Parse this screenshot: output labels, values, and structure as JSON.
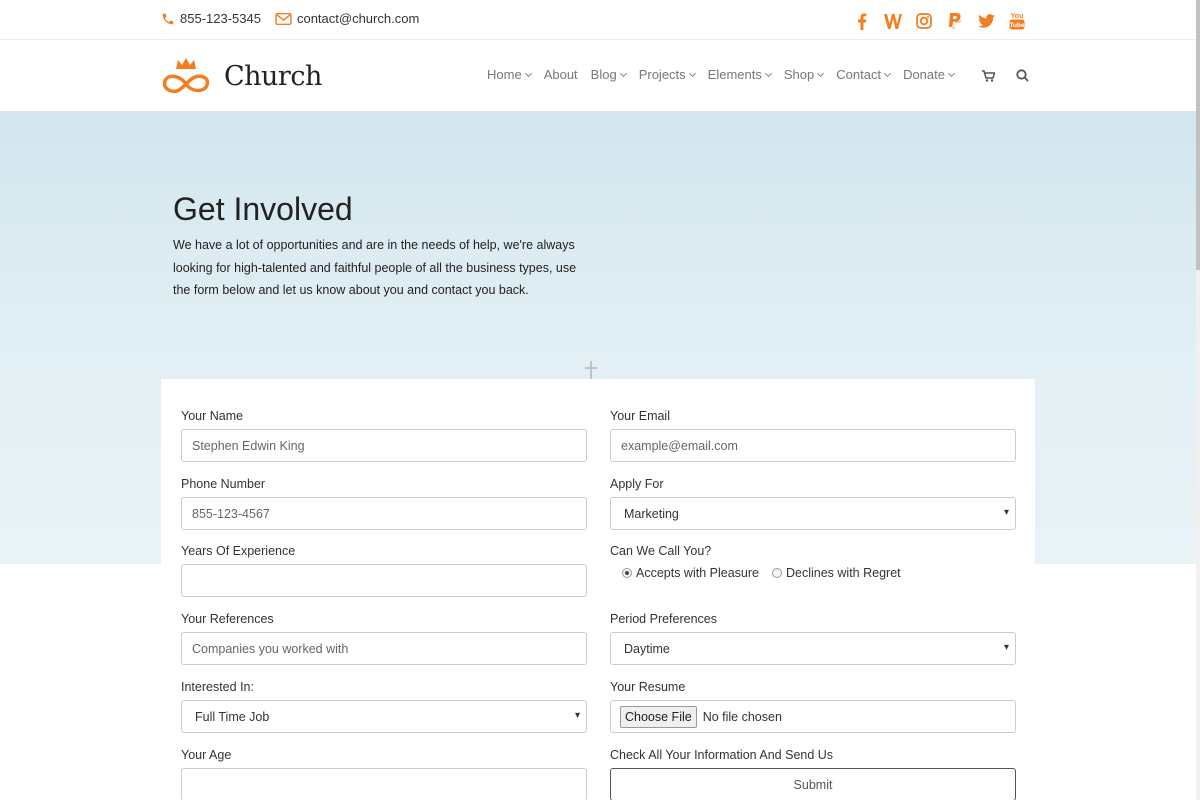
{
  "topbar": {
    "phone": "855-123-5345",
    "email": "contact@church.com",
    "social": [
      "facebook-icon",
      "w-icon",
      "instagram-icon",
      "paypal-icon",
      "twitter-icon",
      "youtube-icon"
    ]
  },
  "brand": {
    "name": "Church",
    "accent": "#f47d20"
  },
  "nav": {
    "items": [
      {
        "label": "Home",
        "dropdown": true
      },
      {
        "label": "About",
        "dropdown": false
      },
      {
        "label": "Blog",
        "dropdown": true
      },
      {
        "label": "Projects",
        "dropdown": true
      },
      {
        "label": "Elements",
        "dropdown": true
      },
      {
        "label": "Shop",
        "dropdown": true
      },
      {
        "label": "Contact",
        "dropdown": true
      },
      {
        "label": "Donate",
        "dropdown": true
      }
    ]
  },
  "hero": {
    "title": "Get Involved",
    "text": "We have a lot of opportunities and are in the needs of help, we're always looking for high-talented and faithful people of all the business types, use the form below and let us know about you and contact you back."
  },
  "form": {
    "name": {
      "label": "Your Name",
      "value": "Stephen Edwin King"
    },
    "email": {
      "label": "Your Email",
      "placeholder": "example@email.com"
    },
    "phone": {
      "label": "Phone Number",
      "value": "855-123-4567"
    },
    "apply": {
      "label": "Apply For",
      "selected": "Marketing"
    },
    "experience": {
      "label": "Years Of Experience",
      "value": ""
    },
    "callback": {
      "label": "Can We Call You?",
      "option_yes": "Accepts with Pleasure",
      "option_no": "Declines with Regret"
    },
    "references": {
      "label": "Your References",
      "placeholder": "Companies you worked with"
    },
    "period": {
      "label": "Period Preferences",
      "selected": "Daytime"
    },
    "interested": {
      "label": "Interested In:",
      "selected": "Full Time Job"
    },
    "resume": {
      "label": "Your Resume",
      "button": "Choose File",
      "status": "No file chosen"
    },
    "age": {
      "label": "Your Age",
      "value": ""
    },
    "send": {
      "label": "Check All Your Information And Send Us",
      "button": "Submit"
    }
  }
}
